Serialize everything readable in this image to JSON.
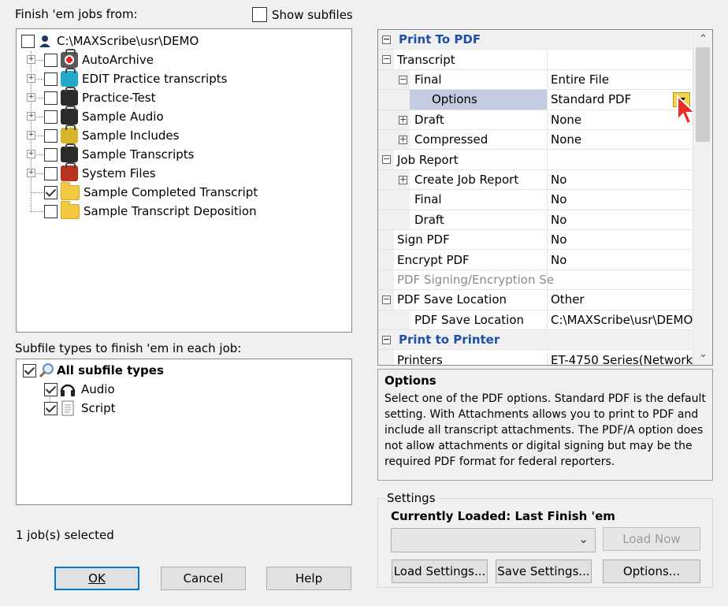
{
  "top": {
    "finish_from_label": "Finish 'em jobs from:",
    "show_subfiles_label": "Show subfiles",
    "show_subfiles_checked": false
  },
  "job_tree": {
    "root": {
      "path": "C:\\MAXScribe\\usr\\DEMO",
      "icon": "user-icon",
      "checked": false
    },
    "items": [
      {
        "label": "AutoArchive",
        "icon": "first-aid-kit-icon",
        "color": "#5a5a5a",
        "checked": false,
        "expandable": true
      },
      {
        "label": "EDIT Practice transcripts",
        "icon": "briefcase-teal-icon",
        "color": "#23a9c9",
        "checked": false,
        "expandable": true
      },
      {
        "label": "Practice-Test",
        "icon": "briefcase-black-icon",
        "color": "#2b2b2b",
        "checked": false,
        "expandable": true
      },
      {
        "label": "Sample Audio",
        "icon": "briefcase-black-icon",
        "color": "#2b2b2b",
        "checked": false,
        "expandable": true
      },
      {
        "label": "Sample Includes",
        "icon": "briefcase-yellow-icon",
        "color": "#d6b52a",
        "checked": false,
        "expandable": true
      },
      {
        "label": "Sample Transcripts",
        "icon": "briefcase-black-icon",
        "color": "#2b2b2b",
        "checked": false,
        "expandable": true
      },
      {
        "label": "System Files",
        "icon": "briefcase-red-icon",
        "color": "#b8321f",
        "checked": false,
        "expandable": true
      },
      {
        "label": "Sample Completed Transcript",
        "icon": "folder-icon",
        "color": "#f5c842",
        "checked": true,
        "expandable": false
      },
      {
        "label": "Sample Transcript Deposition",
        "icon": "folder-icon",
        "color": "#f5c842",
        "checked": false,
        "expandable": false
      }
    ]
  },
  "subfile": {
    "label": "Subfile types to finish 'em in each job:",
    "all": {
      "label": "All subfile types",
      "checked": true,
      "icon": "search-icon"
    },
    "items": [
      {
        "label": "Audio",
        "checked": true,
        "icon": "headphones-icon"
      },
      {
        "label": "Script",
        "checked": true,
        "icon": "document-icon"
      }
    ]
  },
  "status": {
    "jobs_selected": "1 job(s) selected"
  },
  "buttons": {
    "ok": "OK",
    "cancel": "Cancel",
    "help": "Help"
  },
  "props": {
    "rows": [
      {
        "name": "Print To PDF",
        "value": "",
        "type": "category",
        "exp": "−"
      },
      {
        "name": "Transcript",
        "value": "",
        "type": "group",
        "exp": "−",
        "indent": 0
      },
      {
        "name": "Final",
        "value": "Entire File",
        "type": "prop",
        "exp": "−",
        "indent": 1
      },
      {
        "name": "Options",
        "value": "Standard PDF",
        "type": "selected",
        "indent": 2,
        "dropdown": true
      },
      {
        "name": "Draft",
        "value": "None",
        "type": "prop",
        "exp": "+",
        "indent": 1
      },
      {
        "name": "Compressed",
        "value": "None",
        "type": "prop",
        "exp": "+",
        "indent": 1
      },
      {
        "name": "Job Report",
        "value": "",
        "type": "group",
        "exp": "−",
        "indent": 0
      },
      {
        "name": "Create Job Report",
        "value": "No",
        "type": "prop",
        "exp": "+",
        "indent": 1
      },
      {
        "name": "Final",
        "value": "No",
        "type": "prop",
        "indent": 1
      },
      {
        "name": "Draft",
        "value": "No",
        "type": "prop",
        "indent": 1
      },
      {
        "name": "Sign PDF",
        "value": "No",
        "type": "prop",
        "indent": 0
      },
      {
        "name": "Encrypt PDF",
        "value": "No",
        "type": "prop",
        "indent": 0
      },
      {
        "name": "PDF Signing/Encryption Se",
        "value": "",
        "type": "disabled",
        "indent": 0
      },
      {
        "name": "PDF Save Location",
        "value": "Other",
        "type": "group",
        "exp": "−",
        "indent": 0
      },
      {
        "name": "PDF Save Location",
        "value": "C:\\MAXScribe\\usr\\DEMO",
        "type": "prop",
        "indent": 1
      },
      {
        "name": "Print to Printer",
        "value": "",
        "type": "category",
        "exp": "−"
      },
      {
        "name": "Printers",
        "value": "ET-4750 Series(Network)",
        "type": "prop",
        "indent": 0
      }
    ]
  },
  "description": {
    "title": "Options",
    "text": "Select one of the PDF options. Standard PDF is the default setting.  With Attachments allows you to print to PDF and include all transcript attachments.  The PDF/A option does not allow attachments or digital signing but may be the required PDF format for federal reporters."
  },
  "settings": {
    "group_label": "Settings",
    "currently_loaded": "Currently Loaded: Last Finish 'em",
    "combo_value": "",
    "load_now": "Load Now",
    "load_settings": "Load Settings...",
    "save_settings": "Save Settings...",
    "options": "Options..."
  },
  "colors": {
    "accent": "#0078d7",
    "category_text": "#1f4fa8",
    "selected_row": "#c5cbe0"
  }
}
